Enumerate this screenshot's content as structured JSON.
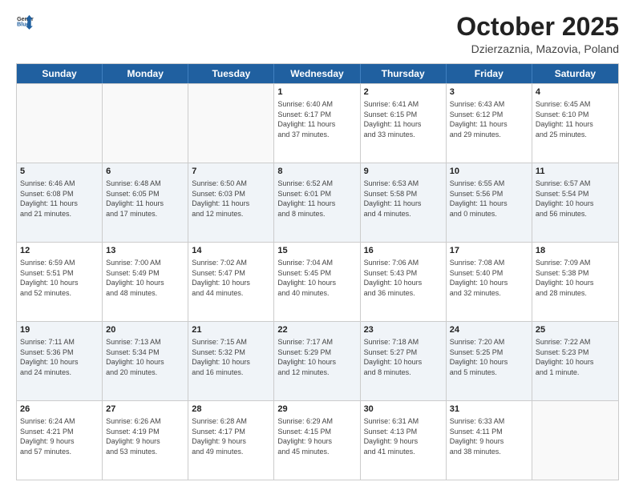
{
  "header": {
    "logo_general": "General",
    "logo_blue": "Blue",
    "month_title": "October 2025",
    "location": "Dzierzaznia, Mazovia, Poland"
  },
  "days_of_week": [
    "Sunday",
    "Monday",
    "Tuesday",
    "Wednesday",
    "Thursday",
    "Friday",
    "Saturday"
  ],
  "weeks": [
    {
      "alt": false,
      "cells": [
        {
          "day": "",
          "info": ""
        },
        {
          "day": "",
          "info": ""
        },
        {
          "day": "",
          "info": ""
        },
        {
          "day": "1",
          "info": "Sunrise: 6:40 AM\nSunset: 6:17 PM\nDaylight: 11 hours\nand 37 minutes."
        },
        {
          "day": "2",
          "info": "Sunrise: 6:41 AM\nSunset: 6:15 PM\nDaylight: 11 hours\nand 33 minutes."
        },
        {
          "day": "3",
          "info": "Sunrise: 6:43 AM\nSunset: 6:12 PM\nDaylight: 11 hours\nand 29 minutes."
        },
        {
          "day": "4",
          "info": "Sunrise: 6:45 AM\nSunset: 6:10 PM\nDaylight: 11 hours\nand 25 minutes."
        }
      ]
    },
    {
      "alt": true,
      "cells": [
        {
          "day": "5",
          "info": "Sunrise: 6:46 AM\nSunset: 6:08 PM\nDaylight: 11 hours\nand 21 minutes."
        },
        {
          "day": "6",
          "info": "Sunrise: 6:48 AM\nSunset: 6:05 PM\nDaylight: 11 hours\nand 17 minutes."
        },
        {
          "day": "7",
          "info": "Sunrise: 6:50 AM\nSunset: 6:03 PM\nDaylight: 11 hours\nand 12 minutes."
        },
        {
          "day": "8",
          "info": "Sunrise: 6:52 AM\nSunset: 6:01 PM\nDaylight: 11 hours\nand 8 minutes."
        },
        {
          "day": "9",
          "info": "Sunrise: 6:53 AM\nSunset: 5:58 PM\nDaylight: 11 hours\nand 4 minutes."
        },
        {
          "day": "10",
          "info": "Sunrise: 6:55 AM\nSunset: 5:56 PM\nDaylight: 11 hours\nand 0 minutes."
        },
        {
          "day": "11",
          "info": "Sunrise: 6:57 AM\nSunset: 5:54 PM\nDaylight: 10 hours\nand 56 minutes."
        }
      ]
    },
    {
      "alt": false,
      "cells": [
        {
          "day": "12",
          "info": "Sunrise: 6:59 AM\nSunset: 5:51 PM\nDaylight: 10 hours\nand 52 minutes."
        },
        {
          "day": "13",
          "info": "Sunrise: 7:00 AM\nSunset: 5:49 PM\nDaylight: 10 hours\nand 48 minutes."
        },
        {
          "day": "14",
          "info": "Sunrise: 7:02 AM\nSunset: 5:47 PM\nDaylight: 10 hours\nand 44 minutes."
        },
        {
          "day": "15",
          "info": "Sunrise: 7:04 AM\nSunset: 5:45 PM\nDaylight: 10 hours\nand 40 minutes."
        },
        {
          "day": "16",
          "info": "Sunrise: 7:06 AM\nSunset: 5:43 PM\nDaylight: 10 hours\nand 36 minutes."
        },
        {
          "day": "17",
          "info": "Sunrise: 7:08 AM\nSunset: 5:40 PM\nDaylight: 10 hours\nand 32 minutes."
        },
        {
          "day": "18",
          "info": "Sunrise: 7:09 AM\nSunset: 5:38 PM\nDaylight: 10 hours\nand 28 minutes."
        }
      ]
    },
    {
      "alt": true,
      "cells": [
        {
          "day": "19",
          "info": "Sunrise: 7:11 AM\nSunset: 5:36 PM\nDaylight: 10 hours\nand 24 minutes."
        },
        {
          "day": "20",
          "info": "Sunrise: 7:13 AM\nSunset: 5:34 PM\nDaylight: 10 hours\nand 20 minutes."
        },
        {
          "day": "21",
          "info": "Sunrise: 7:15 AM\nSunset: 5:32 PM\nDaylight: 10 hours\nand 16 minutes."
        },
        {
          "day": "22",
          "info": "Sunrise: 7:17 AM\nSunset: 5:29 PM\nDaylight: 10 hours\nand 12 minutes."
        },
        {
          "day": "23",
          "info": "Sunrise: 7:18 AM\nSunset: 5:27 PM\nDaylight: 10 hours\nand 8 minutes."
        },
        {
          "day": "24",
          "info": "Sunrise: 7:20 AM\nSunset: 5:25 PM\nDaylight: 10 hours\nand 5 minutes."
        },
        {
          "day": "25",
          "info": "Sunrise: 7:22 AM\nSunset: 5:23 PM\nDaylight: 10 hours\nand 1 minute."
        }
      ]
    },
    {
      "alt": false,
      "cells": [
        {
          "day": "26",
          "info": "Sunrise: 6:24 AM\nSunset: 4:21 PM\nDaylight: 9 hours\nand 57 minutes."
        },
        {
          "day": "27",
          "info": "Sunrise: 6:26 AM\nSunset: 4:19 PM\nDaylight: 9 hours\nand 53 minutes."
        },
        {
          "day": "28",
          "info": "Sunrise: 6:28 AM\nSunset: 4:17 PM\nDaylight: 9 hours\nand 49 minutes."
        },
        {
          "day": "29",
          "info": "Sunrise: 6:29 AM\nSunset: 4:15 PM\nDaylight: 9 hours\nand 45 minutes."
        },
        {
          "day": "30",
          "info": "Sunrise: 6:31 AM\nSunset: 4:13 PM\nDaylight: 9 hours\nand 41 minutes."
        },
        {
          "day": "31",
          "info": "Sunrise: 6:33 AM\nSunset: 4:11 PM\nDaylight: 9 hours\nand 38 minutes."
        },
        {
          "day": "",
          "info": ""
        }
      ]
    }
  ]
}
